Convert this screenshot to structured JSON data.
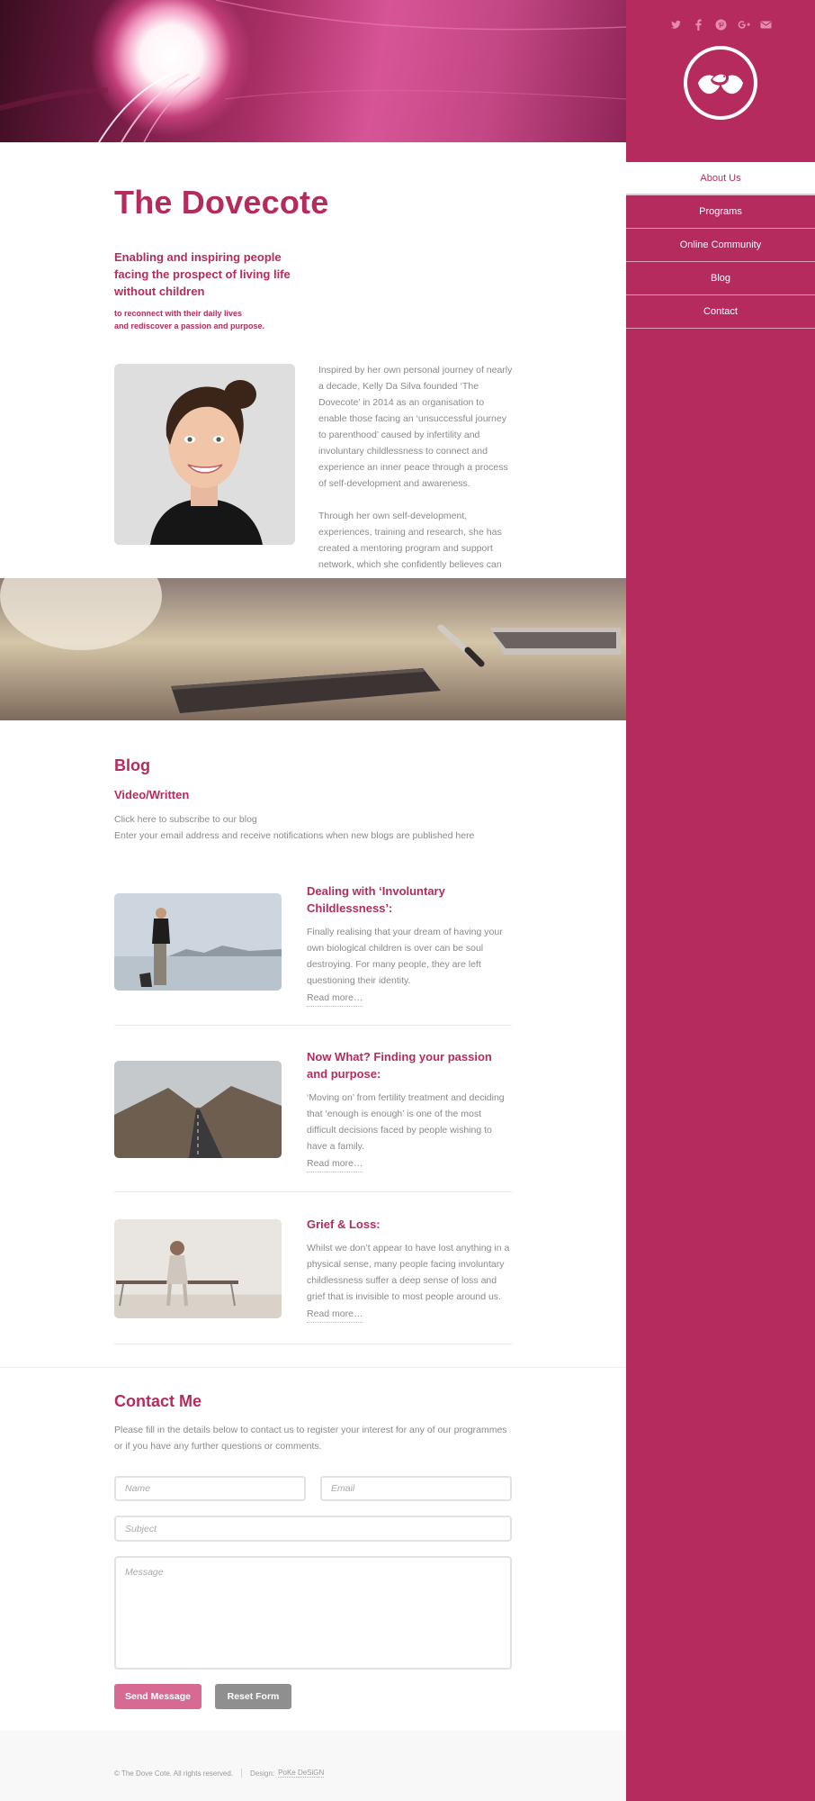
{
  "site": {
    "title": "The Dovecote",
    "tagline": "Enabling and inspiring people facing the prospect of living life without children",
    "subtagline_1": "to reconnect with their daily lives",
    "subtagline_2": "and rediscover a passion and purpose."
  },
  "social_icons": [
    "twitter-icon",
    "facebook-icon",
    "pinterest-icon",
    "google-plus-icon",
    "email-icon"
  ],
  "nav": {
    "items": [
      {
        "label": "About Us",
        "active": true
      },
      {
        "label": "Programs",
        "active": false
      },
      {
        "label": "Online Community",
        "active": false
      },
      {
        "label": "Blog",
        "active": false
      },
      {
        "label": "Contact",
        "active": false
      }
    ]
  },
  "about": {
    "paragraph_1": "Inspired by her own personal journey of nearly a decade, Kelly Da Silva founded ‘The Dovecote’ in 2014 as an organisation to enable those facing an ‘unsuccessful journey to parenthood’ caused by infertility and involuntary childlessness to connect and experience an inner peace through a process of self-development and awareness.",
    "paragraph_2": "Through her own self-development, experiences, training and research, she has created a mentoring program and support network, which she confidently believes can be"
  },
  "blog": {
    "heading": "Blog",
    "subheading": "Video/Written",
    "intro_line_1": "Click here to subscribe to our blog",
    "intro_line_2": "Enter your email address and receive notifications when new blogs are published here",
    "posts": [
      {
        "title": "Dealing with ‘Involuntary Childlessness’:",
        "excerpt": "Finally realising that your dream of having your own biological children is over can be soul destroying. For many people, they are left questioning their identity.",
        "read_more": "Read more…"
      },
      {
        "title": "Now What? Finding your passion and purpose:",
        "excerpt": "‘Moving on’ from fertility treatment and deciding that ‘enough is enough’ is one of the most difficult decisions faced by people wishing to have a family.",
        "read_more": "Read more…"
      },
      {
        "title": "Grief & Loss:",
        "excerpt": "Whilst we don’t appear to have lost anything in a physical sense, many people facing involuntary childlessness suffer a deep sense of loss and grief that is invisible to most people around us.",
        "read_more": "Read more…"
      }
    ]
  },
  "contact": {
    "heading": "Contact Me",
    "intro": "Please fill in the details below to contact us to register your interest for any of our programmes or if you have any further questions or comments.",
    "name_placeholder": "Name",
    "email_placeholder": "Email",
    "subject_placeholder": "Subject",
    "message_placeholder": "Message",
    "send_label": "Send Message",
    "reset_label": "Reset Form"
  },
  "footer": {
    "copyright": "© The Dove Cote. All rights reserved.",
    "design_label": "Design:",
    "design_link": "PoKe DeSiGN"
  },
  "colors": {
    "brand": "#b52b5d",
    "send_button": "#d76a93",
    "reset_button": "#8f8f8f"
  }
}
